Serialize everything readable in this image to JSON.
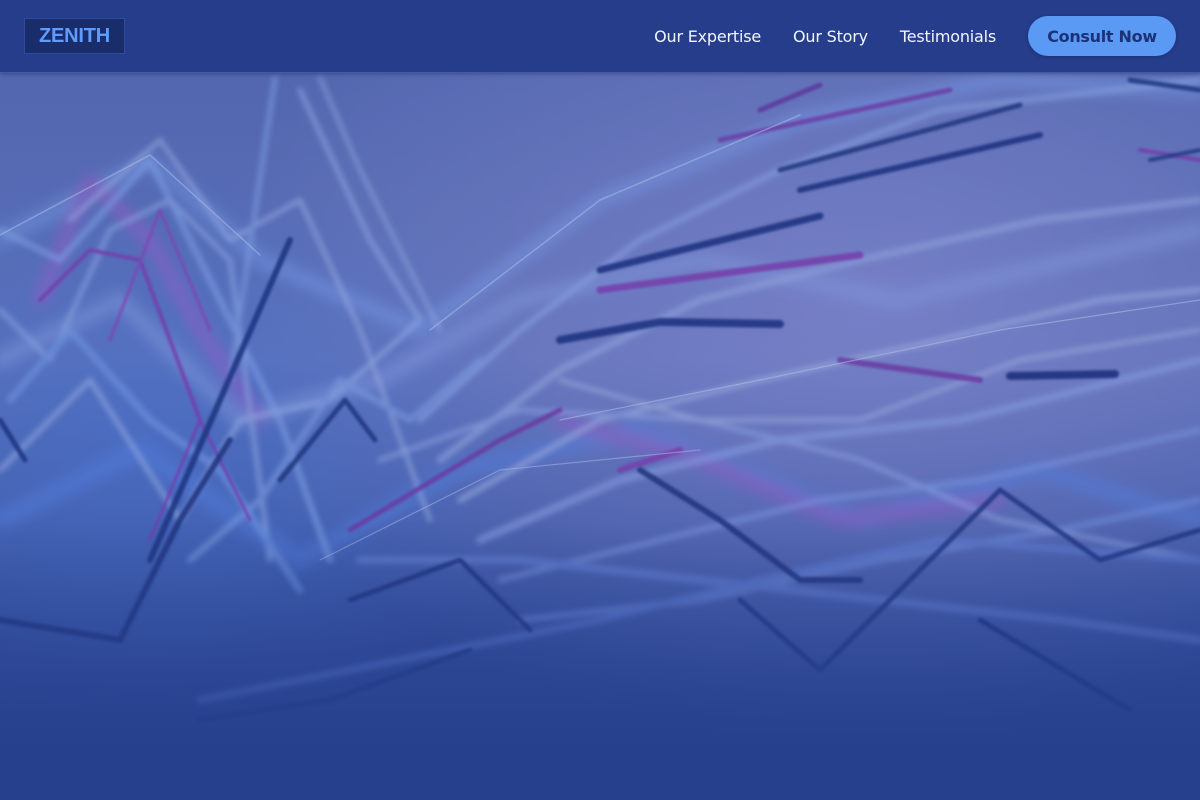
{
  "brand": {
    "logo_text": "ZENITH"
  },
  "nav": {
    "links": [
      {
        "label": "Our Expertise"
      },
      {
        "label": "Our Story"
      },
      {
        "label": "Testimonials"
      }
    ],
    "cta_label": "Consult Now"
  },
  "hero": {
    "background": "abstract-glowing-line-waves"
  },
  "colors": {
    "header_bg": "#253d8a",
    "logo_bg": "#1a2d6b",
    "logo_text": "#5e9cff",
    "cta_bg": "#5a9af5",
    "cta_text": "#1b3277",
    "hero_overlay": "#26408e",
    "line_accent_magenta": "#c04bd6",
    "line_accent_blue": "#7fb0ff"
  }
}
